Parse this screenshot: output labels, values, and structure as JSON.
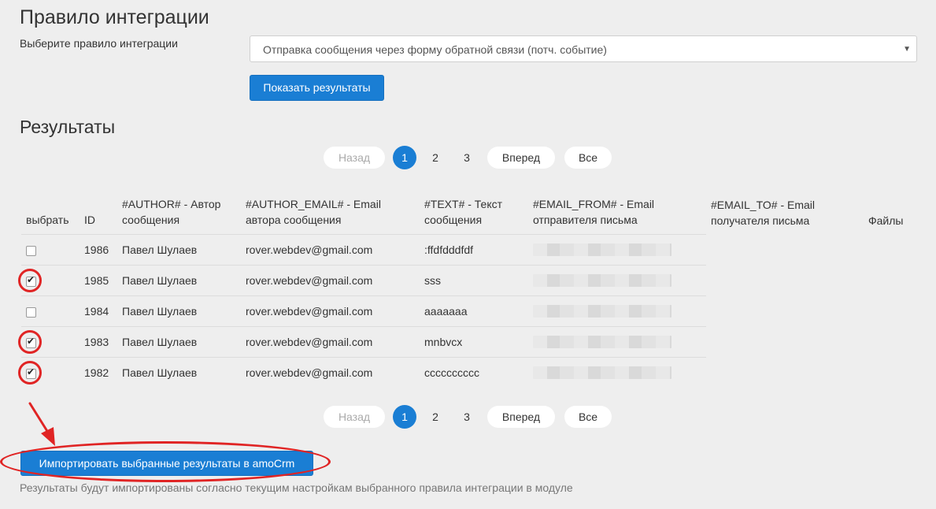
{
  "header": {
    "title": "Правило интеграции",
    "rule_label": "Выберите правило интеграции",
    "rule_selected": "Отправка сообщения через форму обратной связи (потч. событие)",
    "show_button": "Показать результаты"
  },
  "results": {
    "title": "Результаты",
    "pagination": {
      "prev": "Назад",
      "pages": [
        "1",
        "2",
        "3"
      ],
      "active_page": "1",
      "next": "Вперед",
      "all": "Все"
    },
    "columns": {
      "select": "выбрать",
      "id": "ID",
      "author_1": "#AUTHOR# - Автор",
      "author_2": "сообщения",
      "author_email_1": "#AUTHOR_EMAIL# - Email",
      "author_email_2": "автора сообщения",
      "text_1": "#TEXT# - Текст",
      "text_2": "сообщения",
      "email_from_1": "#EMAIL_FROM# - Email",
      "email_from_2": "отправителя письма",
      "email_to_1": "#EMAIL_TO# - Email",
      "email_to_2": "получателя письма",
      "files": "Файлы"
    },
    "rows": [
      {
        "id": "1986",
        "author": "Павел Шулаев",
        "email": "rover.webdev@gmail.com",
        "text": ":ffdfdddfdf",
        "checked": false
      },
      {
        "id": "1985",
        "author": "Павел Шулаев",
        "email": "rover.webdev@gmail.com",
        "text": "sss",
        "checked": true
      },
      {
        "id": "1984",
        "author": "Павел Шулаев",
        "email": "rover.webdev@gmail.com",
        "text": "ааааааа",
        "checked": false
      },
      {
        "id": "1983",
        "author": "Павел Шулаев",
        "email": "rover.webdev@gmail.com",
        "text": "mnbvcx",
        "checked": true
      },
      {
        "id": "1982",
        "author": "Павел Шулаев",
        "email": "rover.webdev@gmail.com",
        "text": "cccccccccc",
        "checked": true
      }
    ]
  },
  "footer": {
    "import_button": "Импортировать выбранные результаты в amoCrm",
    "note": "Результаты будут импортированы согласно текущим настройкам выбранного правила интеграции в модуле"
  },
  "colors": {
    "accent": "#1a7ed4",
    "annotation": "#e02424",
    "background": "#eeeeee"
  }
}
